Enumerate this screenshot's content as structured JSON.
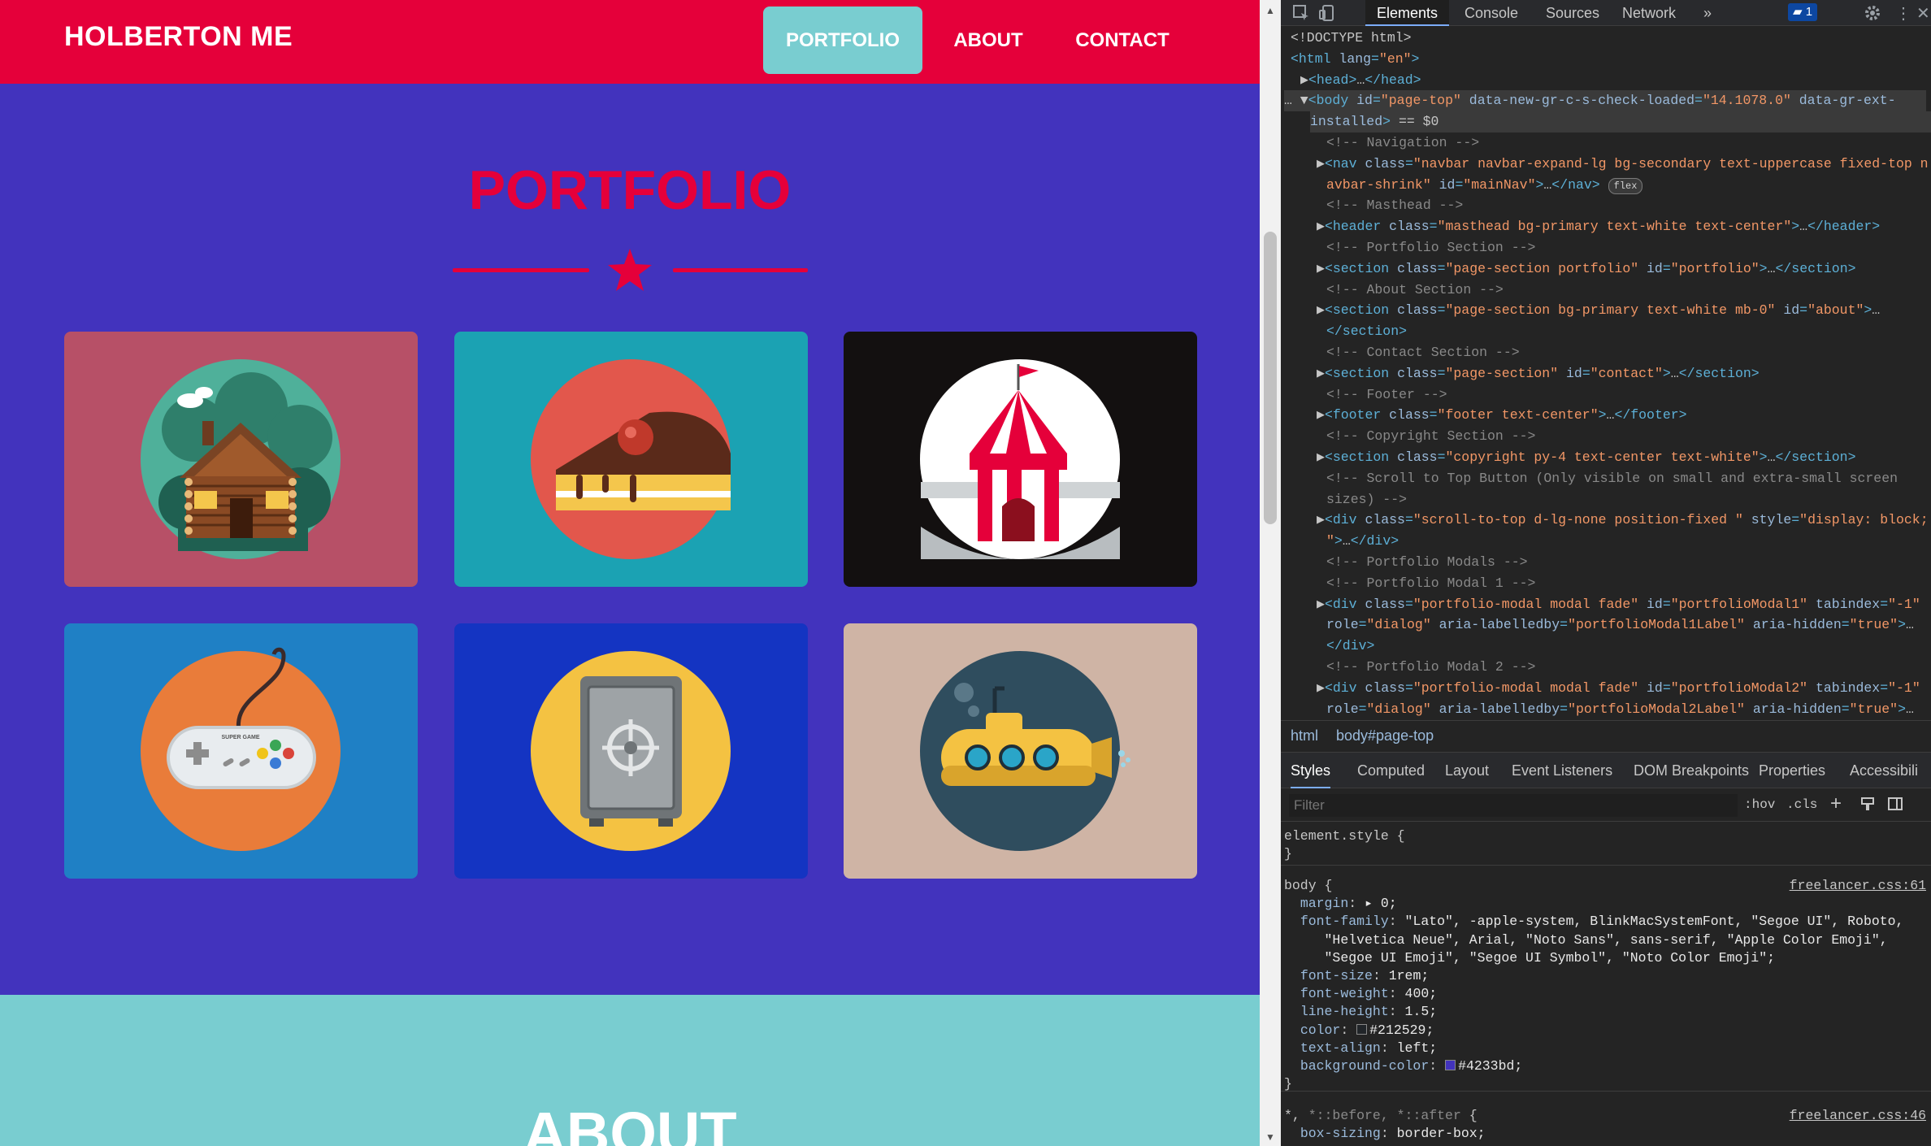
{
  "site": {
    "brand": "HOLBERTON ME",
    "nav": [
      {
        "label": "PORTFOLIO",
        "active": true
      },
      {
        "label": "ABOUT",
        "active": false
      },
      {
        "label": "CONTACT",
        "active": false
      }
    ],
    "portfolio_heading": "PORTFOLIO",
    "about_heading": "ABOUT",
    "colors": {
      "primary": "#4233bd",
      "secondary": "#e5003a",
      "accent": "#79cdd0"
    },
    "portfolio_items": [
      {
        "icon": "cabin-icon",
        "bg": "#b75067"
      },
      {
        "icon": "cake-icon",
        "bg": "#1ba2b3"
      },
      {
        "icon": "circus-tent-icon",
        "bg": "#131010"
      },
      {
        "icon": "game-controller-icon",
        "bg": "#1f80c5"
      },
      {
        "icon": "safe-icon",
        "bg": "#1434c2"
      },
      {
        "icon": "submarine-icon",
        "bg": "#cfb4a5"
      }
    ],
    "controller_text": "SUPER GAME"
  },
  "devtools": {
    "tabs": [
      "Elements",
      "Console",
      "Sources",
      "Network"
    ],
    "more": "»",
    "badge_count": "1",
    "breadcrumbs": [
      "html",
      "body#page-top"
    ],
    "style_tabs": [
      "Styles",
      "Computed",
      "Layout",
      "Event Listeners",
      "DOM Breakpoints",
      "Properties",
      "Accessibili"
    ],
    "filter_placeholder": "Filter",
    "hov": ":hov",
    "cls": ".cls",
    "flex_badge": "flex"
  }
}
